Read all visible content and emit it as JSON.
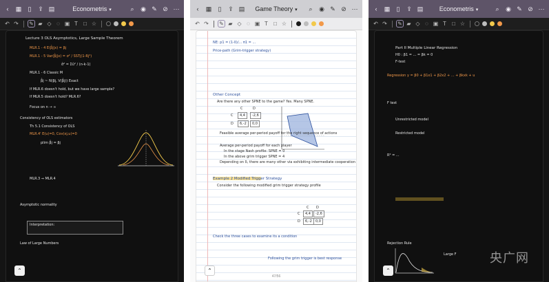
{
  "panels": [
    {
      "title": "Econometris",
      "lines": [
        "Lecture 3  OLS Asymptotics, Large Sample Theorem",
        "MLR.1 - 4   E(β̂j|x) = βj",
        "MLR.1 - 5   Var(β̂j|x) = σ² / SSTj(1-Rj²)",
        "σ̂² = Σû² / (n-k-1)",
        "MLR.1 - 6   Classic M",
        "β̂j ~ N(βj, V(β̂j))     Exact",
        "If MLR.6 doesn't hold,  but we have large sample?",
        "If MLR.5 doesn't hold?  MLR.6?",
        "Focus on n → ∞",
        "Consistency of OLS estimators",
        "Th 5.1  Consistency of OLS",
        "MLR.4'  E(u)=0,  Cov(xj,u)=0",
        "plim β̂j = βj",
        "MLR.3  ⇒  MLR.4",
        "Asymptotic normality",
        "Interpretation:",
        "Law of Large Numbers"
      ]
    },
    {
      "title": "Game Theory",
      "lines": [
        "NE:  p1 = (1-δ)/...   π1 = ...",
        "Price-path  (Grim-trigger strategy)",
        "Other Concept",
        "Are there any other SPNE to the game? Yes. Many SPNE.",
        "Feasible average per-period payoff for the right sequence of actions",
        "Average per-period payoff for each player",
        "In the stage Nash profile: SPNE = 0",
        "In the above grim trigger SPNE = 4",
        "Depending on δ, there are many other via exhibiting intermediate cooperation",
        "Example 2  Modified Trigger Strategy",
        "Consider the following modified grim trigger strategy profile",
        "Check the three cases to examine its a condition",
        "Following the grim trigger is best response"
      ],
      "matrix": {
        "cols": [
          "C",
          "D"
        ],
        "rows": [
          "C",
          "D"
        ],
        "cells": [
          [
            "4,4",
            "-2,6"
          ],
          [
            "6,-2",
            "0,0"
          ]
        ]
      },
      "matrix2": {
        "cols": [
          "C",
          "D"
        ],
        "rows": [
          "C",
          "D"
        ],
        "cells": [
          [
            "4,4",
            "-2,6"
          ],
          [
            "6,-2",
            "0,0"
          ]
        ]
      },
      "page_number": "47/56"
    },
    {
      "title": "Econometris",
      "lines": [
        "Part II   Multiple Linear Regression",
        "H0 : β1 = ... = βk = 0",
        "F-test",
        "Regression  y = β0 + β1x1 + β2x2 + ... + βkxk + u",
        "F test",
        "Unrestricted model",
        "Restricted model",
        "R² = ...",
        "Rejection Rule",
        "Large F"
      ]
    }
  ],
  "icons": {
    "back": "chevron-left-icon",
    "grid": "grid-icon",
    "bookmark": "bookmark-icon",
    "export": "export-icon",
    "doc": "document-icon",
    "search": "search-icon",
    "mic": "microphone-icon",
    "pen": "pen-icon",
    "hide": "eye-off-icon",
    "more": "more-icon"
  },
  "colors": {
    "accent_purple": "#5e5468",
    "swatch_1": "#1a1a1a",
    "swatch_2": "#bdbdbd",
    "swatch_3": "#f2c94c",
    "swatch_4": "#f2994a"
  },
  "watermark": "央广网"
}
